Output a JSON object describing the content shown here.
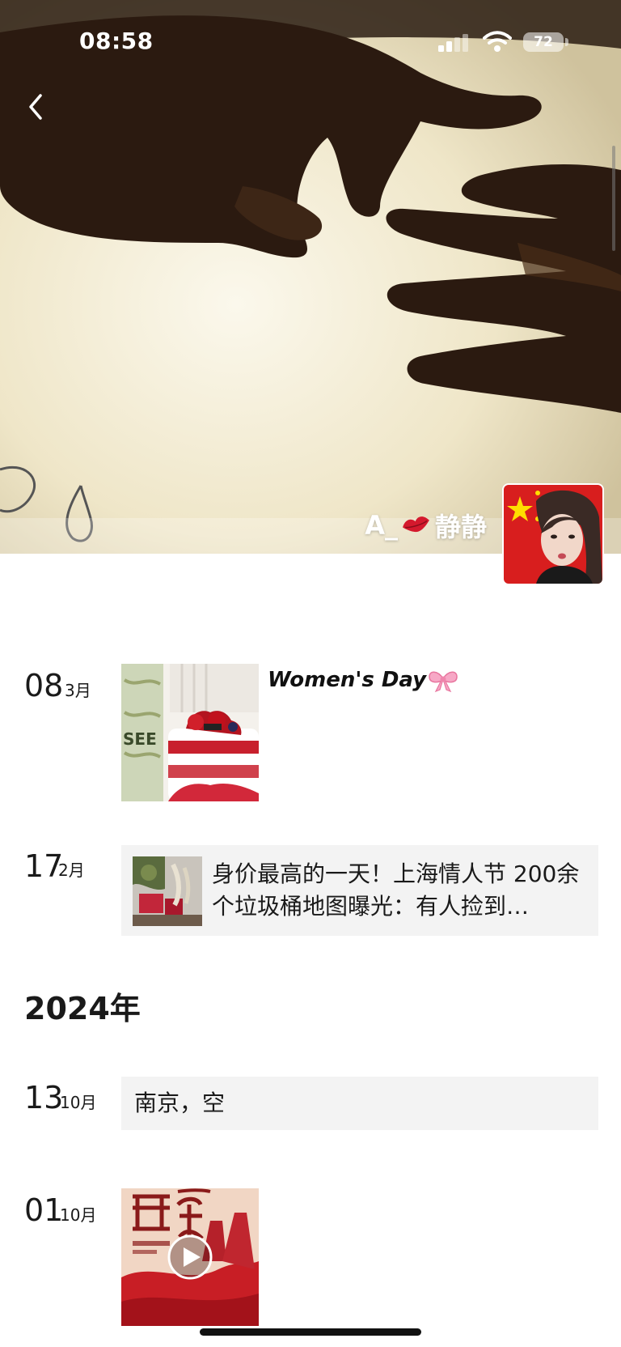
{
  "status_bar": {
    "time": "08:58",
    "battery": "72"
  },
  "profile": {
    "name_prefix": "A_",
    "name_suffix": "静静"
  },
  "timeline": {
    "entries": [
      {
        "day": "08",
        "month": "3月",
        "text": "Women's Day"
      },
      {
        "day": "17",
        "month": "2月",
        "text": "身价最高的一天！上海情人节 200余个垃圾桶地图曝光：有人捡到…"
      }
    ],
    "year_header": "2024年",
    "entries_2024": [
      {
        "day": "13",
        "month": "10月",
        "text": "南京，空"
      },
      {
        "day": "01",
        "month": "10月"
      }
    ]
  },
  "icons": {
    "back": "chevron-left-icon",
    "signal": "signal-icon",
    "wifi": "wifi-icon",
    "kiss": "kiss-lips-icon",
    "bow": "ribbon-bow-icon",
    "play": "play-icon"
  },
  "colors": {
    "card_background": "#f3f3f3",
    "text_primary": "#1a1a1a"
  }
}
